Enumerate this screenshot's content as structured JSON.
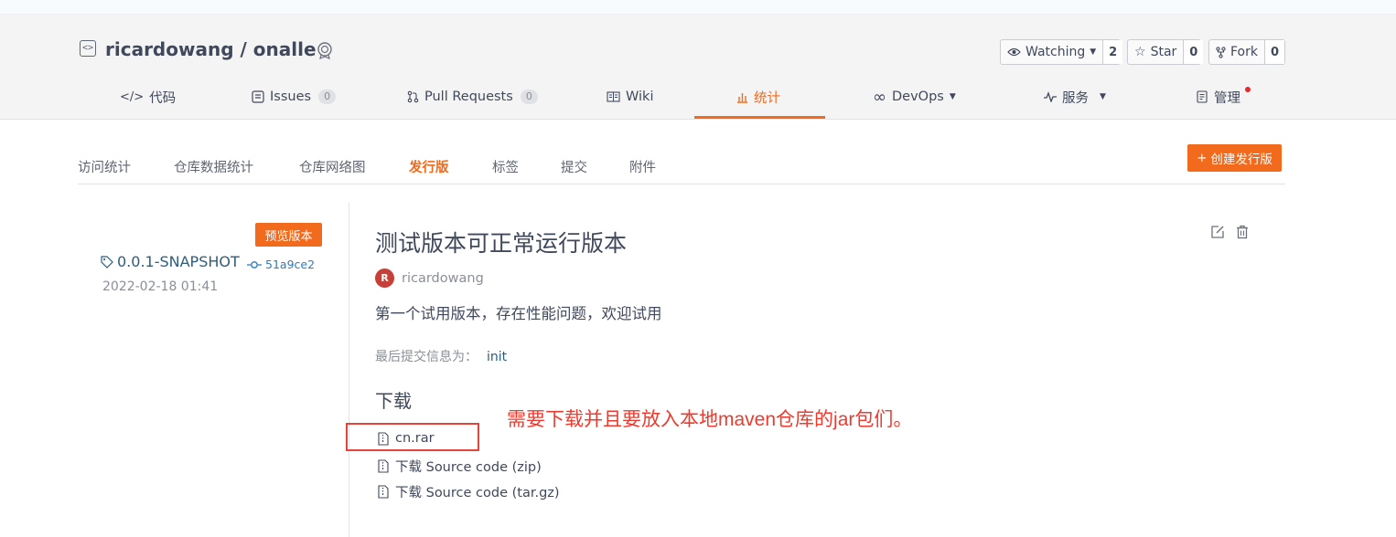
{
  "repo": {
    "owner": "ricardowang",
    "separator": "/",
    "name": "onalle"
  },
  "actions": {
    "watch": {
      "label": "Watching",
      "count": "2"
    },
    "star": {
      "label": "Star",
      "count": "0"
    },
    "fork": {
      "label": "Fork",
      "count": "0"
    }
  },
  "nav": {
    "code": "代码",
    "issues": {
      "label": "Issues",
      "count": "0"
    },
    "pulls": {
      "label": "Pull Requests",
      "count": "0"
    },
    "wiki": "Wiki",
    "stats": "统计",
    "devops": "DevOps",
    "services": "服务",
    "manage": "管理"
  },
  "subnav": {
    "visits": "访问统计",
    "repo_data": "仓库数据统计",
    "network": "仓库网络图",
    "releases": "发行版",
    "tags": "标签",
    "commits": "提交",
    "attachments": "附件",
    "create_release": "创建发行版"
  },
  "release": {
    "preview_badge": "预览版本",
    "tag": "0.0.1-SNAPSHOT",
    "commit": "51a9ce2",
    "date": "2022-02-18 01:41",
    "title": "测试版本可正常运行版本",
    "author_initial": "R",
    "author": "ricardowang",
    "description": "第一个试用版本，存在性能问题，欢迎试用",
    "last_commit_label": "最后提交信息为：",
    "last_commit_value": "init"
  },
  "downloads": {
    "title": "下载",
    "items": [
      "cn.rar",
      "下载 Source code (zip)",
      "下载 Source code (tar.gz)"
    ]
  },
  "annotation": {
    "text": "需要下载并且要放入本地maven仓库的jar包们。"
  },
  "colors": {
    "accent": "#f26a1b",
    "annotation_red": "#ed3b2f",
    "link": "#2c5e7c"
  }
}
